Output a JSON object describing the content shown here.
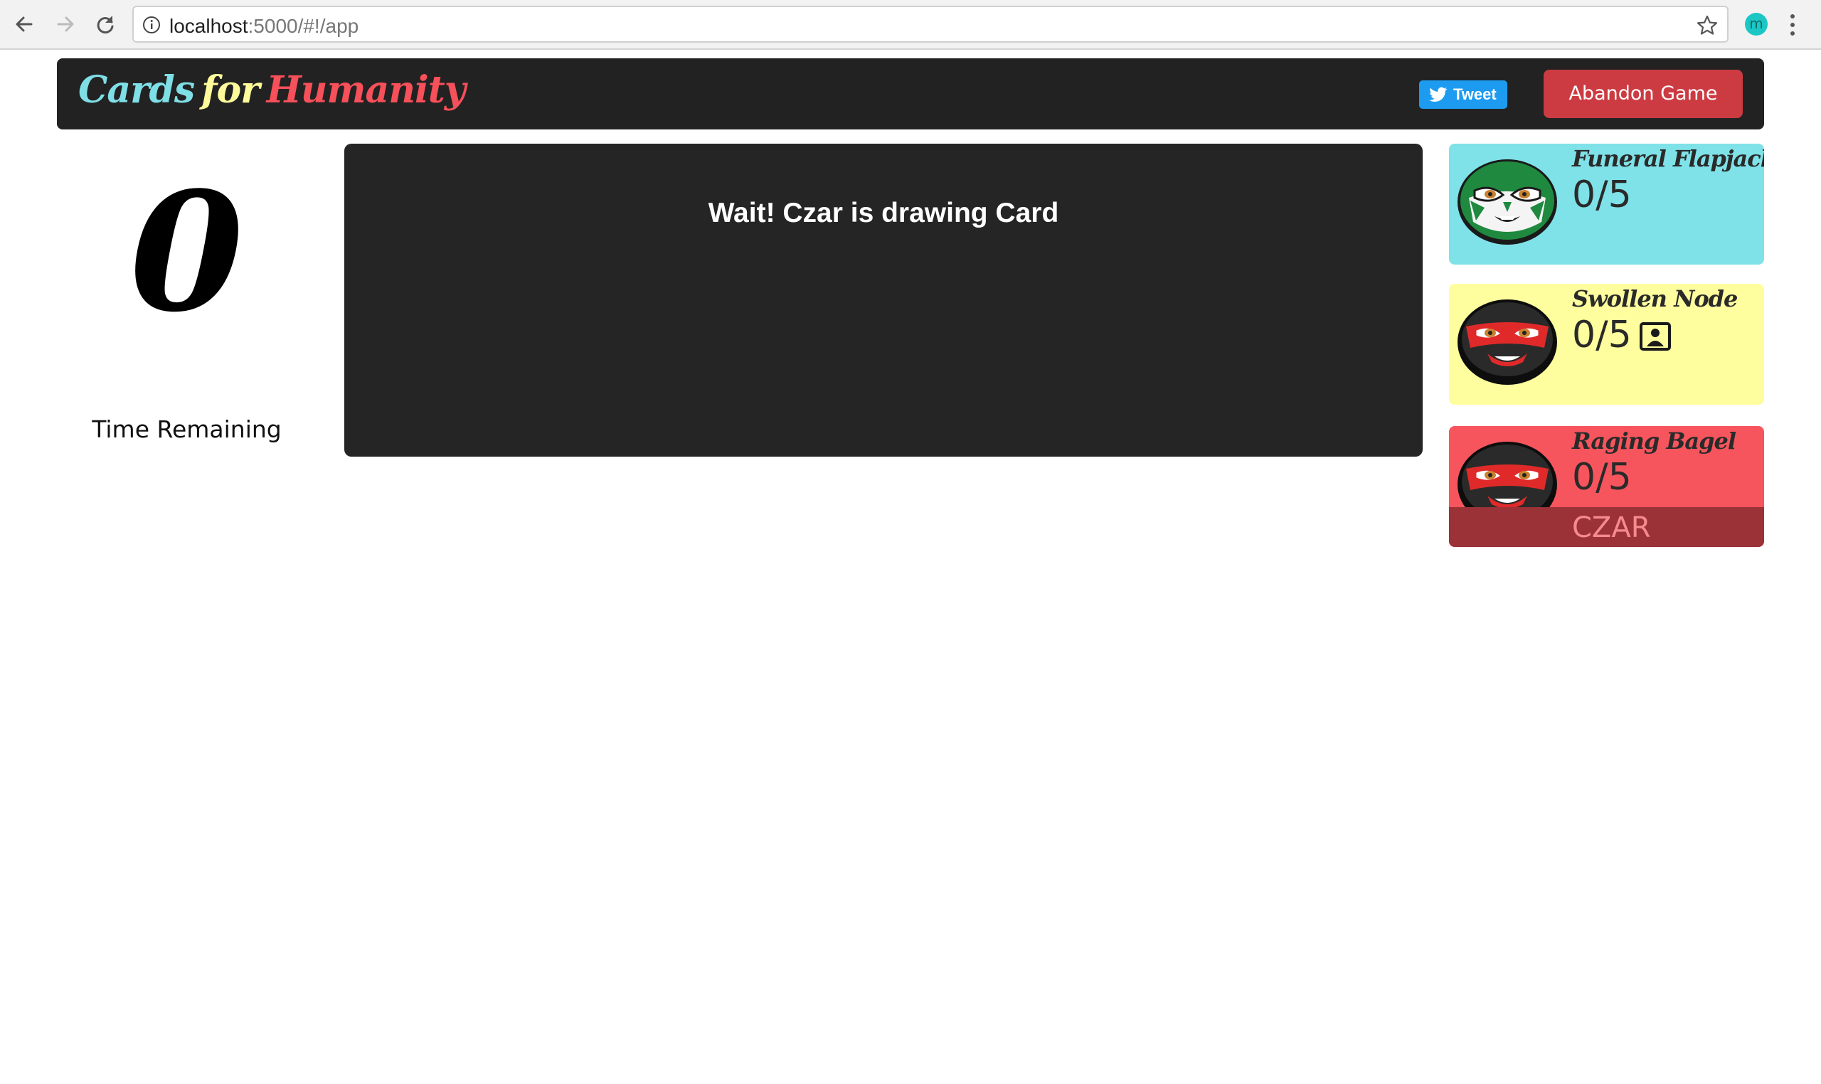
{
  "browser": {
    "url_host": "localhost",
    "url_rest": ":5000/#!/app",
    "extension_letter": "m"
  },
  "header": {
    "logo": {
      "word1": "Cards",
      "word2": "for",
      "word3": "Humanity"
    },
    "tweet_label": "Tweet",
    "abandon_label": "Abandon Game"
  },
  "timer": {
    "value": "0",
    "label": "Time Remaining"
  },
  "board": {
    "message": "Wait! Czar is drawing Card"
  },
  "players": [
    {
      "name": "Funeral Flapjack",
      "score": "0/5",
      "color": "#7fe2e8",
      "mask": "green-luchador"
    },
    {
      "name": "Swollen Node",
      "score": "0/5",
      "color": "#fefe9e",
      "mask": "black-red-luchador",
      "has_card_icon": true
    },
    {
      "name": "Raging Bagel",
      "score": "0/5",
      "color": "#f7555d",
      "mask": "black-red-luchador",
      "badge": "CZAR"
    }
  ],
  "colors": {
    "header_bg": "#222222",
    "abandon_bg": "#cc3b42",
    "tweet_bg": "#1d9bf0",
    "board_bg": "#252525"
  }
}
